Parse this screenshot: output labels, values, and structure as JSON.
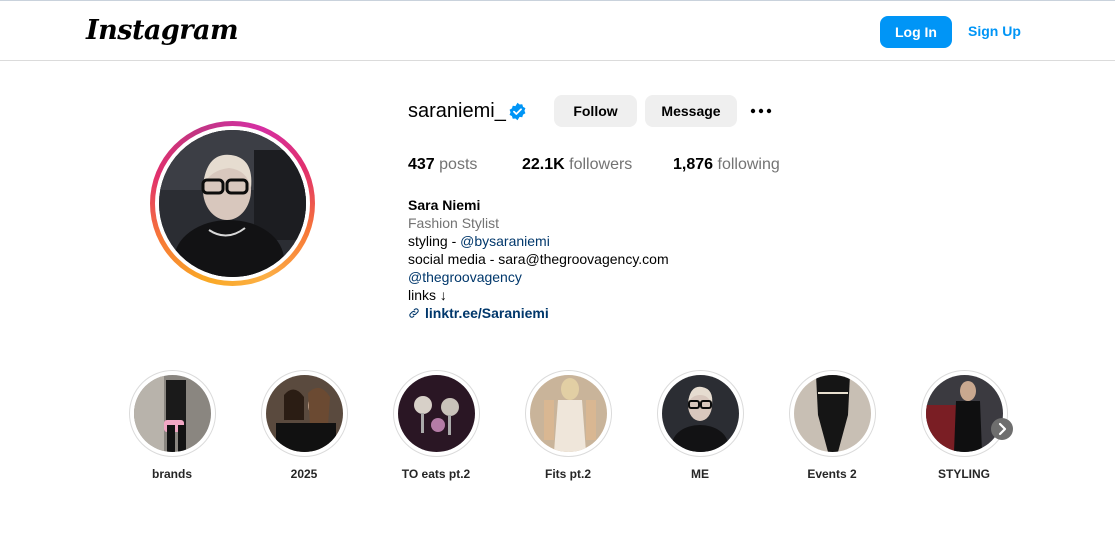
{
  "header": {
    "logo": "Instagram",
    "login_label": "Log In",
    "signup_label": "Sign Up",
    "accent_color": "#0095f6"
  },
  "profile": {
    "username": "saraniemi_",
    "verified": true,
    "follow_label": "Follow",
    "message_label": "Message",
    "more_icon": "more-horizontal-icon",
    "stats": {
      "posts_value": "437",
      "posts_label": "posts",
      "followers_value": "22.1K",
      "followers_label": "followers",
      "following_value": "1,876",
      "following_label": "following"
    },
    "bio": {
      "name": "Sara Niemi",
      "category": "Fashion Stylist",
      "line1_prefix": "styling - ",
      "line1_handle": "@bysaraniemi",
      "line2": "social media - sara@thegroovagency.com",
      "line3_handle": "@thegroovagency",
      "line4": "links ↓",
      "link": "linktr.ee/Saraniemi",
      "link_icon": "link-icon"
    }
  },
  "highlights": [
    {
      "label": "brands"
    },
    {
      "label": "2025"
    },
    {
      "label": "TO eats pt.2"
    },
    {
      "label": "Fits pt.2"
    },
    {
      "label": "ME"
    },
    {
      "label": "Events 2"
    },
    {
      "label": "STYLING"
    }
  ],
  "highlights_next_icon": "chevron-right-icon"
}
